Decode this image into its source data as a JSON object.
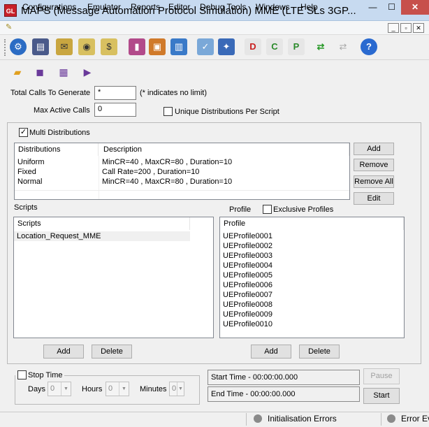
{
  "window": {
    "title": "MAPS (Message Automation Protocol Simulation) MME (LTE SLs 3GP...",
    "logo_text": "GL",
    "minimize": "—",
    "maximize": "☐",
    "close": "✕"
  },
  "menu": [
    "Configurations",
    "Emulator",
    "Reports",
    "Editor",
    "Debug Tools",
    "Windows",
    "Help"
  ],
  "mdi_controls": [
    "_",
    "▫",
    "✕"
  ],
  "toolbar_icons": [
    "settings-gear-icon",
    "script-notebook-icon",
    "message-editor-icon",
    "coins-icon",
    "coins-alt-icon",
    "pc-blocks-icon",
    "briefcase-icon",
    "network-pc-icon",
    "edit-check-icon",
    "config-tool-icon",
    "report-d-icon",
    "report-c-icon",
    "report-p-icon",
    "capture-c-icon",
    "capture-disabled-icon",
    "help-icon"
  ],
  "sub_toolbar_icons": [
    "open-folder-icon",
    "save-icon",
    "save-as-icon",
    "video-icon"
  ],
  "form": {
    "total_calls_label": "Total Calls To Generate",
    "total_calls_value": "*",
    "no_limit_note": "(* indicates no limit)",
    "max_active_label": "Max Active Calls",
    "max_active_value": "0",
    "unique_dist_label": "Unique Distributions Per Script"
  },
  "distributions": {
    "multi_label": "Multi Distributions",
    "multi_checked": "✓",
    "columns": [
      "Distributions",
      "Description"
    ],
    "rows": [
      {
        "name": "Uniform",
        "desc": "MinCR=40 , MaxCR=80 , Duration=10"
      },
      {
        "name": "Fixed",
        "desc": "Call Rate=200 , Duration=10"
      },
      {
        "name": "Normal",
        "desc": "MinCR=40 , MaxCR=80 , Duration=10"
      }
    ],
    "buttons": {
      "add": "Add",
      "remove": "Remove",
      "remove_all": "Remove All",
      "edit": "Edit"
    }
  },
  "scripts": {
    "group_label": "Scripts",
    "column": "Scripts",
    "items": [
      "Location_Request_MME"
    ],
    "add": "Add",
    "delete": "Delete"
  },
  "profiles": {
    "group_label": "Profile",
    "exclusive_label": "Exclusive Profiles",
    "column": "Profile",
    "items": [
      "UEProfile0001",
      "UEProfile0002",
      "UEProfile0003",
      "UEProfile0004",
      "UEProfile0005",
      "UEProfile0006",
      "UEProfile0007",
      "UEProfile0008",
      "UEProfile0009",
      "UEProfile0010"
    ],
    "add": "Add",
    "delete": "Delete"
  },
  "stop_time": {
    "label": "Stop Time",
    "days_label": "Days",
    "days_value": "0",
    "hours_label": "Hours",
    "hours_value": "0",
    "minutes_label": "Minutes",
    "minutes_value": "0"
  },
  "timing": {
    "start_time": "Start Time - 00:00:00.000",
    "end_time": "End Time  -  00:00:00.000",
    "pause": "Pause",
    "start": "Start"
  },
  "status": {
    "init_errors": "Initialisation Errors",
    "error_ev": "Error Ev"
  }
}
